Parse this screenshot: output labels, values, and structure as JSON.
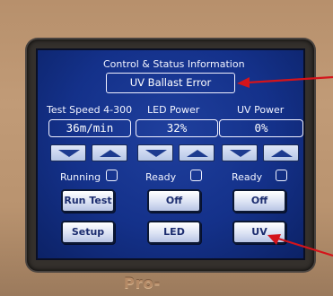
{
  "header": {
    "title": "Control & Status Information",
    "status_message": "UV Ballast Error"
  },
  "columns": [
    {
      "label": "Test Speed 4-300",
      "value": "36m/min",
      "status_label": "Running",
      "status_checked": false,
      "buttons": [
        "Run Test",
        "Setup"
      ]
    },
    {
      "label": "LED Power",
      "value": "32%",
      "status_label": "Ready",
      "status_checked": false,
      "buttons": [
        "Off",
        "LED"
      ]
    },
    {
      "label": "UV Power",
      "value": "0%",
      "status_label": "Ready",
      "status_checked": false,
      "buttons": [
        "Off",
        "UV"
      ]
    }
  ],
  "device": {
    "brand": "Pro-"
  },
  "colors": {
    "screen": "#14318a",
    "annotation_arrow": "#d4141b"
  },
  "icons": [
    "arrow-down-icon",
    "arrow-up-icon"
  ]
}
